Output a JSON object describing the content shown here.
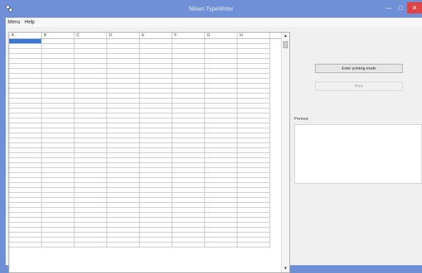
{
  "window": {
    "title": "Nilsen TypeWriter",
    "controls": {
      "minimize": "—",
      "maximize": "□",
      "close": "✕"
    }
  },
  "menu": {
    "items": [
      "Menu",
      "Help"
    ]
  },
  "grid": {
    "columns": [
      "A",
      "B",
      "C",
      "D",
      "E",
      "F",
      "G",
      "H"
    ],
    "row_count": 42,
    "selected_cell": {
      "row": 0,
      "column": "A"
    },
    "selection_color": "#3b79d9"
  },
  "panel": {
    "print_mode_button": "Enter printing mode",
    "print_button": "Print",
    "preview_label": "Preview"
  },
  "colors": {
    "titlebar": "#6f8fd6",
    "close_button": "#e04343"
  }
}
